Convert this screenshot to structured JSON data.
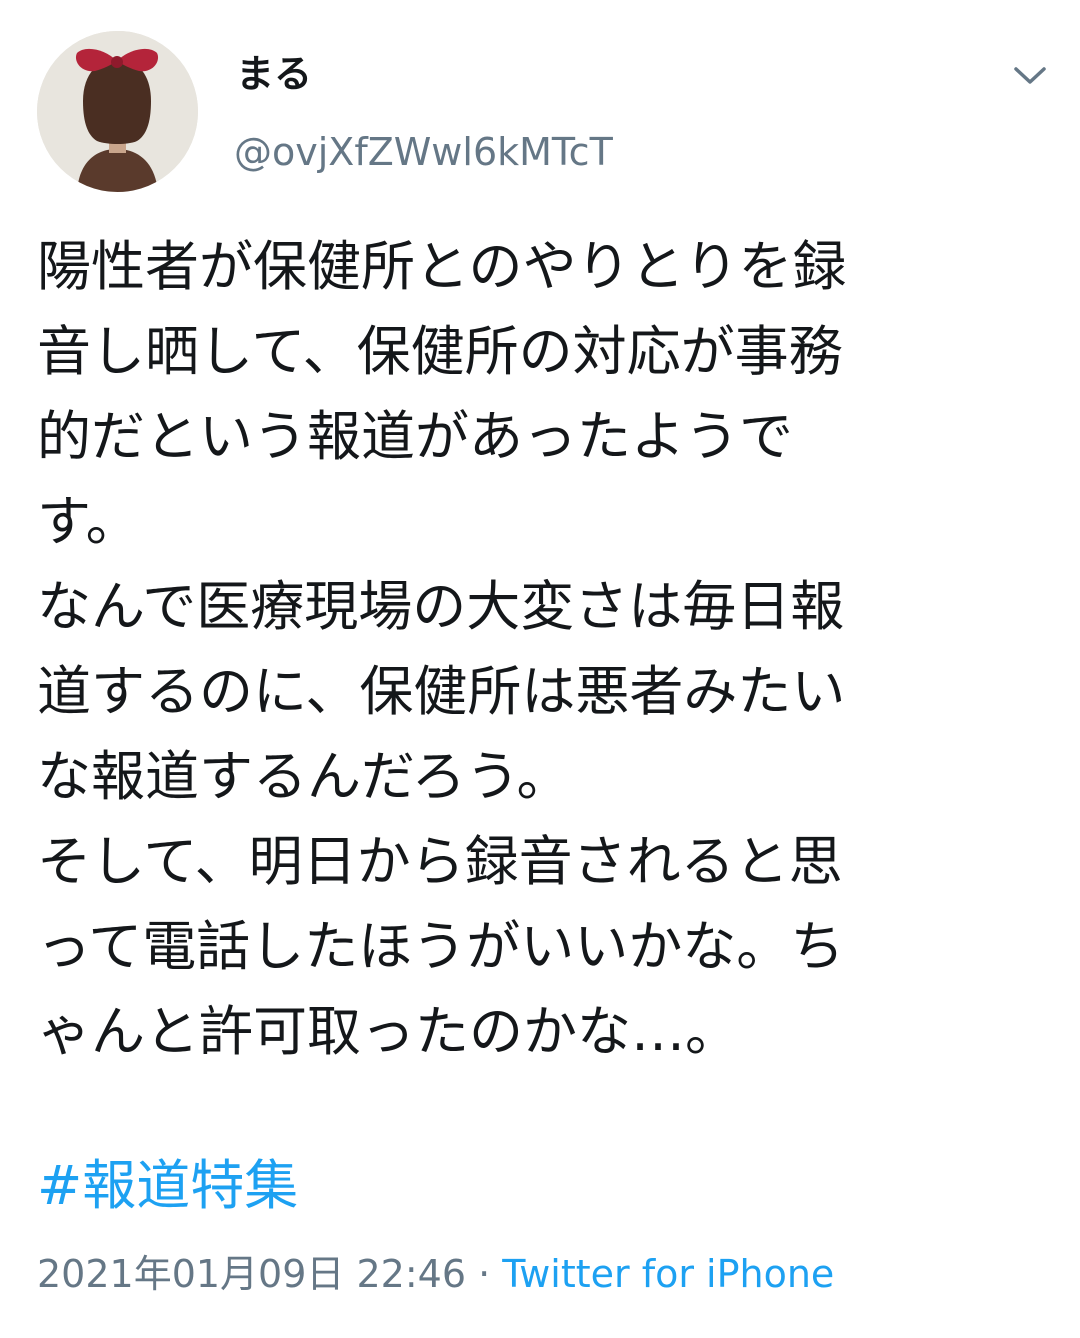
{
  "user": {
    "display_name": "まる",
    "handle": "@ovjXfZWwl6kMTcT",
    "avatar": "avatar-girl-with-red-bow"
  },
  "menu_icon": "chevron-down-icon",
  "tweet": {
    "lines": [
      "陽性者が保健所とのやりとりを録",
      "音し晒して、保健所の対応が事務",
      "的だという報道があったようで",
      "す。",
      "なんで医療現場の大変さは毎日報",
      "道するのに、保健所は悪者みたい",
      "な報道するんだろう。",
      "そして、明日から録音されると思",
      "って電話したほうがいいかな。ち",
      "ゃんと許可取ったのかな…。"
    ],
    "hashtag": "#報道特集",
    "timestamp": "2021年01月09日 22:46",
    "separator": " · ",
    "source": "Twitter for iPhone"
  },
  "colors": {
    "link": "#1da1f2",
    "secondary": "#657786",
    "text": "#14171a"
  }
}
